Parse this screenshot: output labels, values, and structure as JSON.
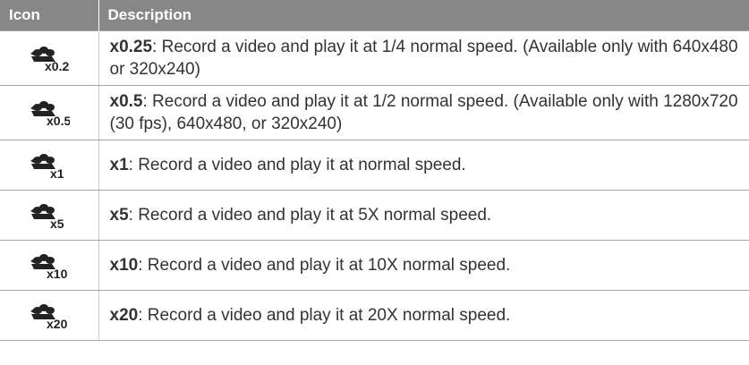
{
  "header": {
    "icon_col": "Icon",
    "desc_col": "Description"
  },
  "rows": [
    {
      "icon": "timelapse-x0.25-icon",
      "icon_label": "x0.25",
      "keyword": "x0.25",
      "text": ": Record a video and play it at 1/4 normal speed. (Available only with 640x480 or 320x240)"
    },
    {
      "icon": "timelapse-x0.5-icon",
      "icon_label": "x0.5",
      "keyword": "x0.5",
      "text": ": Record a video and play it at 1/2 normal speed. (Available only with 1280x720 (30 fps), 640x480, or 320x240)"
    },
    {
      "icon": "timelapse-x1-icon",
      "icon_label": "x1",
      "keyword": "x1",
      "text": ": Record a video and play it at normal speed."
    },
    {
      "icon": "timelapse-x5-icon",
      "icon_label": "x5",
      "keyword": "x5",
      "text": ": Record a video and play it at 5X normal speed."
    },
    {
      "icon": "timelapse-x10-icon",
      "icon_label": "x10",
      "keyword": "x10",
      "text": ": Record a video and play it at 10X normal speed."
    },
    {
      "icon": "timelapse-x20-icon",
      "icon_label": "x20",
      "keyword": "x20",
      "text": ": Record a video and play it at 20X normal speed."
    }
  ]
}
